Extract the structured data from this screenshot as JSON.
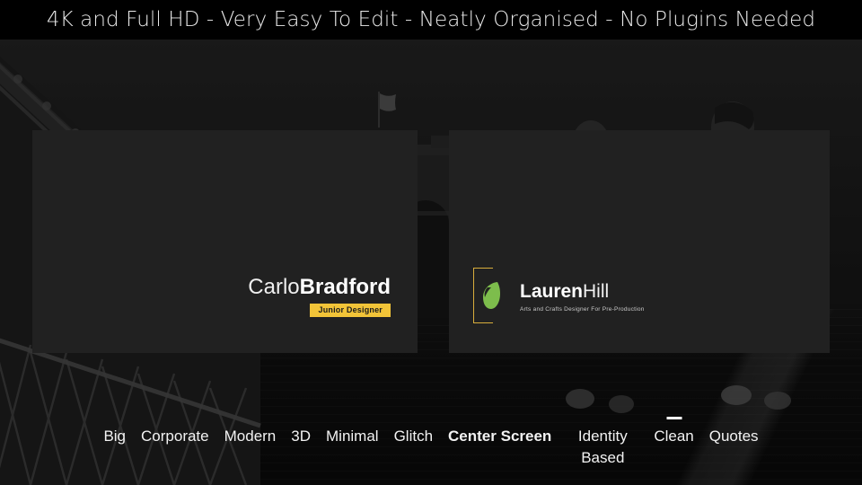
{
  "banner": {
    "text": "4K and Full HD - Very Easy To Edit - Neatly Organised - No Plugins Needed"
  },
  "background": {
    "description": "dark desaturated photo of Brooklyn Bridge walkway with pedestrians",
    "icons": [
      "bridge-truss-icon",
      "bridge-tower-icon",
      "flag-icon",
      "pedestrian-icon"
    ]
  },
  "colors": {
    "panel": "#212121",
    "badge_gold": "#f2c438",
    "bracket_gold": "#d8ad3c",
    "leaf_green": "#7dbd4c",
    "text_white": "#ffffff",
    "backdrop": "#131313"
  },
  "cards": {
    "left": {
      "first_name": "Carlo",
      "last_name": "Bradford",
      "badge": "Junior Designer"
    },
    "right": {
      "first_name": "Lauren",
      "last_name": "Hill",
      "tagline": "Arts and Crafts Designer For Pre-Production",
      "logo": "leaf-logo-icon"
    }
  },
  "nav": {
    "items": [
      {
        "label": "Big",
        "active": false,
        "wrap": false,
        "marker": false
      },
      {
        "label": "Corporate",
        "active": false,
        "wrap": false,
        "marker": false
      },
      {
        "label": "Modern",
        "active": false,
        "wrap": false,
        "marker": false
      },
      {
        "label": "3D",
        "active": false,
        "wrap": false,
        "marker": false
      },
      {
        "label": "Minimal",
        "active": false,
        "wrap": false,
        "marker": false
      },
      {
        "label": "Glitch",
        "active": false,
        "wrap": false,
        "marker": false
      },
      {
        "label": "Center Screen",
        "active": true,
        "wrap": false,
        "marker": false
      },
      {
        "label": "Identity Based",
        "active": false,
        "wrap": true,
        "marker": false
      },
      {
        "label": "Clean",
        "active": false,
        "wrap": false,
        "marker": true
      },
      {
        "label": "Quotes",
        "active": false,
        "wrap": false,
        "marker": false
      }
    ]
  }
}
